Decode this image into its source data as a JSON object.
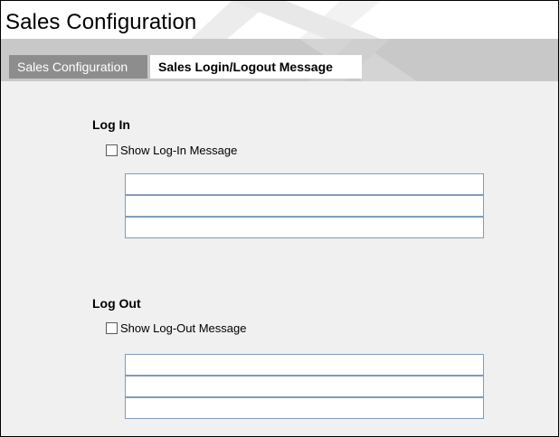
{
  "window": {
    "title": "Sales Configuration"
  },
  "tabs": [
    {
      "label": "Sales Configuration",
      "active": false
    },
    {
      "label": "Sales Login/Logout Message",
      "active": true
    }
  ],
  "login": {
    "heading": "Log In",
    "checkbox_label": "Show Log-In Message",
    "checked": false,
    "lines": [
      "",
      "",
      ""
    ]
  },
  "logout": {
    "heading": "Log Out",
    "checkbox_label": "Show Log-Out Message",
    "checked": false,
    "lines": [
      "",
      "",
      ""
    ]
  },
  "colors": {
    "tab_strip": "#c8c8c8",
    "inactive_tab": "#8d8d8d",
    "content_bg": "#f0f0f0",
    "field_border": "#7f9db9"
  }
}
